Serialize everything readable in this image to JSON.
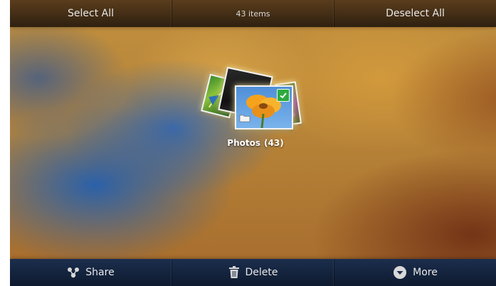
{
  "top_bar": {
    "select_all": "Select All",
    "item_count": "43 items",
    "deselect_all": "Deselect All"
  },
  "album": {
    "name": "Photos",
    "count": "(43)",
    "selected": true
  },
  "bottom_bar": {
    "share": "Share",
    "delete": "Delete",
    "more": "More"
  },
  "icons": {
    "share": "share-icon",
    "delete": "trash-icon",
    "more": "chevron-down-circle-icon",
    "folder": "folder-icon",
    "check": "checkmark-icon"
  },
  "colors": {
    "check_badge": "#2eaa3f",
    "top_bar": "#3f2b14",
    "bottom_bar": "#15243e"
  }
}
